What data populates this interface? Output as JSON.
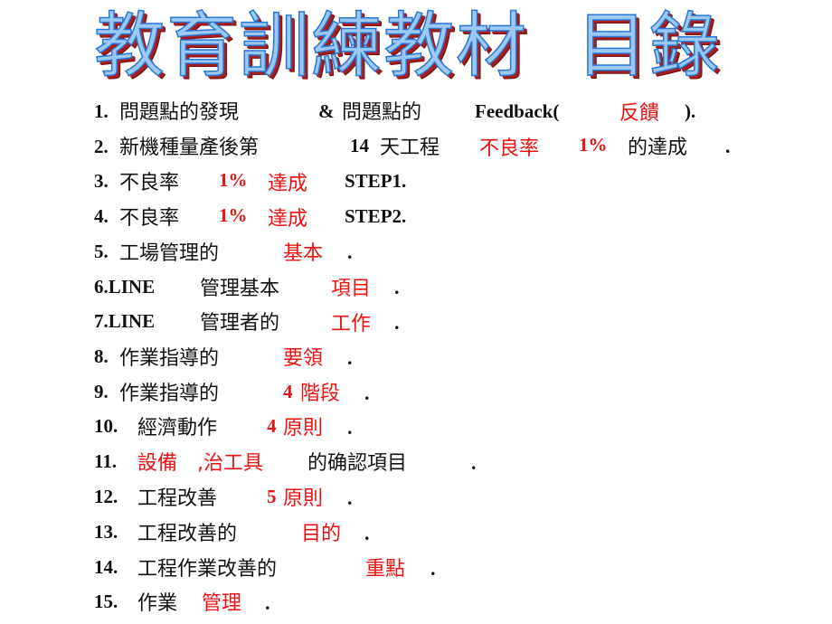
{
  "title": "教育訓練教材  目錄",
  "colors": {
    "text": "#111111",
    "highlight": "#ee1111",
    "title_fill": "#9cc8f4",
    "title_outline": "#2a78d6",
    "title_shadow": "#a51d1d"
  },
  "items": [
    {
      "num": "1.",
      "parts": [
        "問題點的發現",
        "&",
        "問題點的",
        "Feedback(",
        "反饋",
        ")."
      ]
    },
    {
      "num": "2.",
      "parts": [
        "新機種量產後第",
        "14",
        "天工程",
        "不良率",
        "1%",
        "的達成",
        "."
      ]
    },
    {
      "num": "3.",
      "parts": [
        "不良率",
        "1%",
        "達成",
        "STEP1."
      ]
    },
    {
      "num": "4.",
      "parts": [
        "不良率",
        "1%",
        "達成",
        "STEP2."
      ]
    },
    {
      "num": "5.",
      "parts": [
        "工場管理的",
        "基本",
        "."
      ]
    },
    {
      "num": "6.LINE",
      "parts": [
        "管理基本",
        "項目",
        "."
      ]
    },
    {
      "num": "7.LINE",
      "parts": [
        "管理者的",
        "工作",
        "."
      ]
    },
    {
      "num": "8.",
      "parts": [
        "作業指導的",
        "要領",
        "."
      ]
    },
    {
      "num": "9.",
      "parts": [
        "作業指導的",
        "4",
        "階段",
        "."
      ]
    },
    {
      "num": "10.",
      "parts": [
        "經濟動作",
        "4",
        "原則",
        "."
      ]
    },
    {
      "num": "11.",
      "parts": [
        "設備",
        ",治工具",
        "的确認項目",
        "."
      ]
    },
    {
      "num": "12.",
      "parts": [
        "工程改善",
        "5",
        "原則",
        "."
      ]
    },
    {
      "num": "13.",
      "parts": [
        "工程改善的",
        "目的",
        "."
      ]
    },
    {
      "num": "14.",
      "parts": [
        "工程作業改善的",
        "重點",
        "."
      ]
    },
    {
      "num": "15.",
      "parts": [
        "作業",
        "管理",
        "."
      ]
    }
  ]
}
